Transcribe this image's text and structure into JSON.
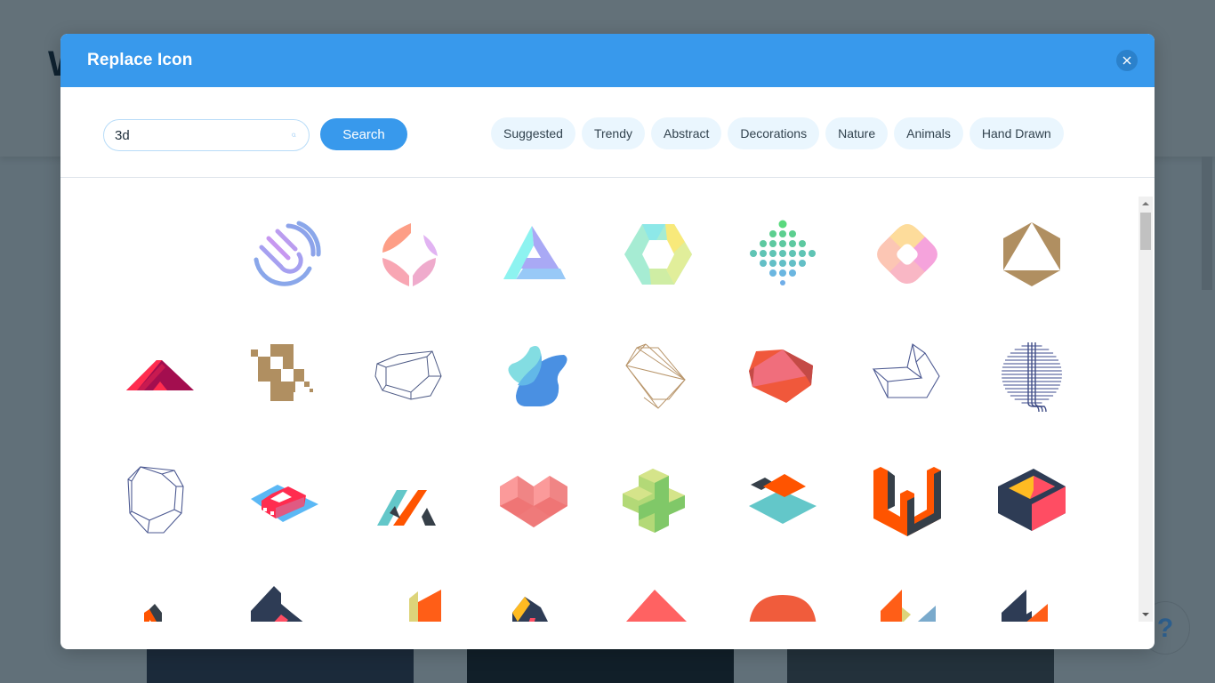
{
  "modal": {
    "title": "Replace Icon",
    "close_label": "×"
  },
  "search": {
    "value": "3d",
    "placeholder": "Search",
    "button_label": "Search"
  },
  "categories": [
    {
      "label": "Suggested"
    },
    {
      "label": "Trendy"
    },
    {
      "label": "Abstract"
    },
    {
      "label": "Decorations"
    },
    {
      "label": "Nature"
    },
    {
      "label": "Animals"
    },
    {
      "label": "Hand Drawn"
    }
  ],
  "icons": [
    "sound-wave-icon",
    "fingerprint-icon",
    "petal-diamond-icon",
    "impossible-triangle-icon",
    "hexagon-ring-icon",
    "dot-arrow-icon",
    "rounded-square-ring-icon",
    "hexagon-triangle-icon",
    "roof-stripes-icon",
    "pixel-blocks-icon",
    "crystal-outline-icon",
    "blob-shapes-icon",
    "geometric-polygon-icon",
    "red-gem-icon",
    "folded-box-outline-icon",
    "striped-circle-icon",
    "gem-outline-icon",
    "isometric-car-icon",
    "stripes-letter-icon",
    "isometric-heart-icon",
    "isometric-plus-icon",
    "layered-diamonds-icon",
    "isometric-w-icon",
    "isometric-open-box-icon",
    "isometric-n-icon",
    "striped-steps-icon",
    "paper-panels-icon",
    "striped-cube-icon",
    "diamond-stack-icon",
    "arch-icon",
    "folded-panels-icon",
    "striped-building-icon"
  ],
  "help": {
    "label": "?"
  },
  "background": {
    "letter": "W"
  }
}
